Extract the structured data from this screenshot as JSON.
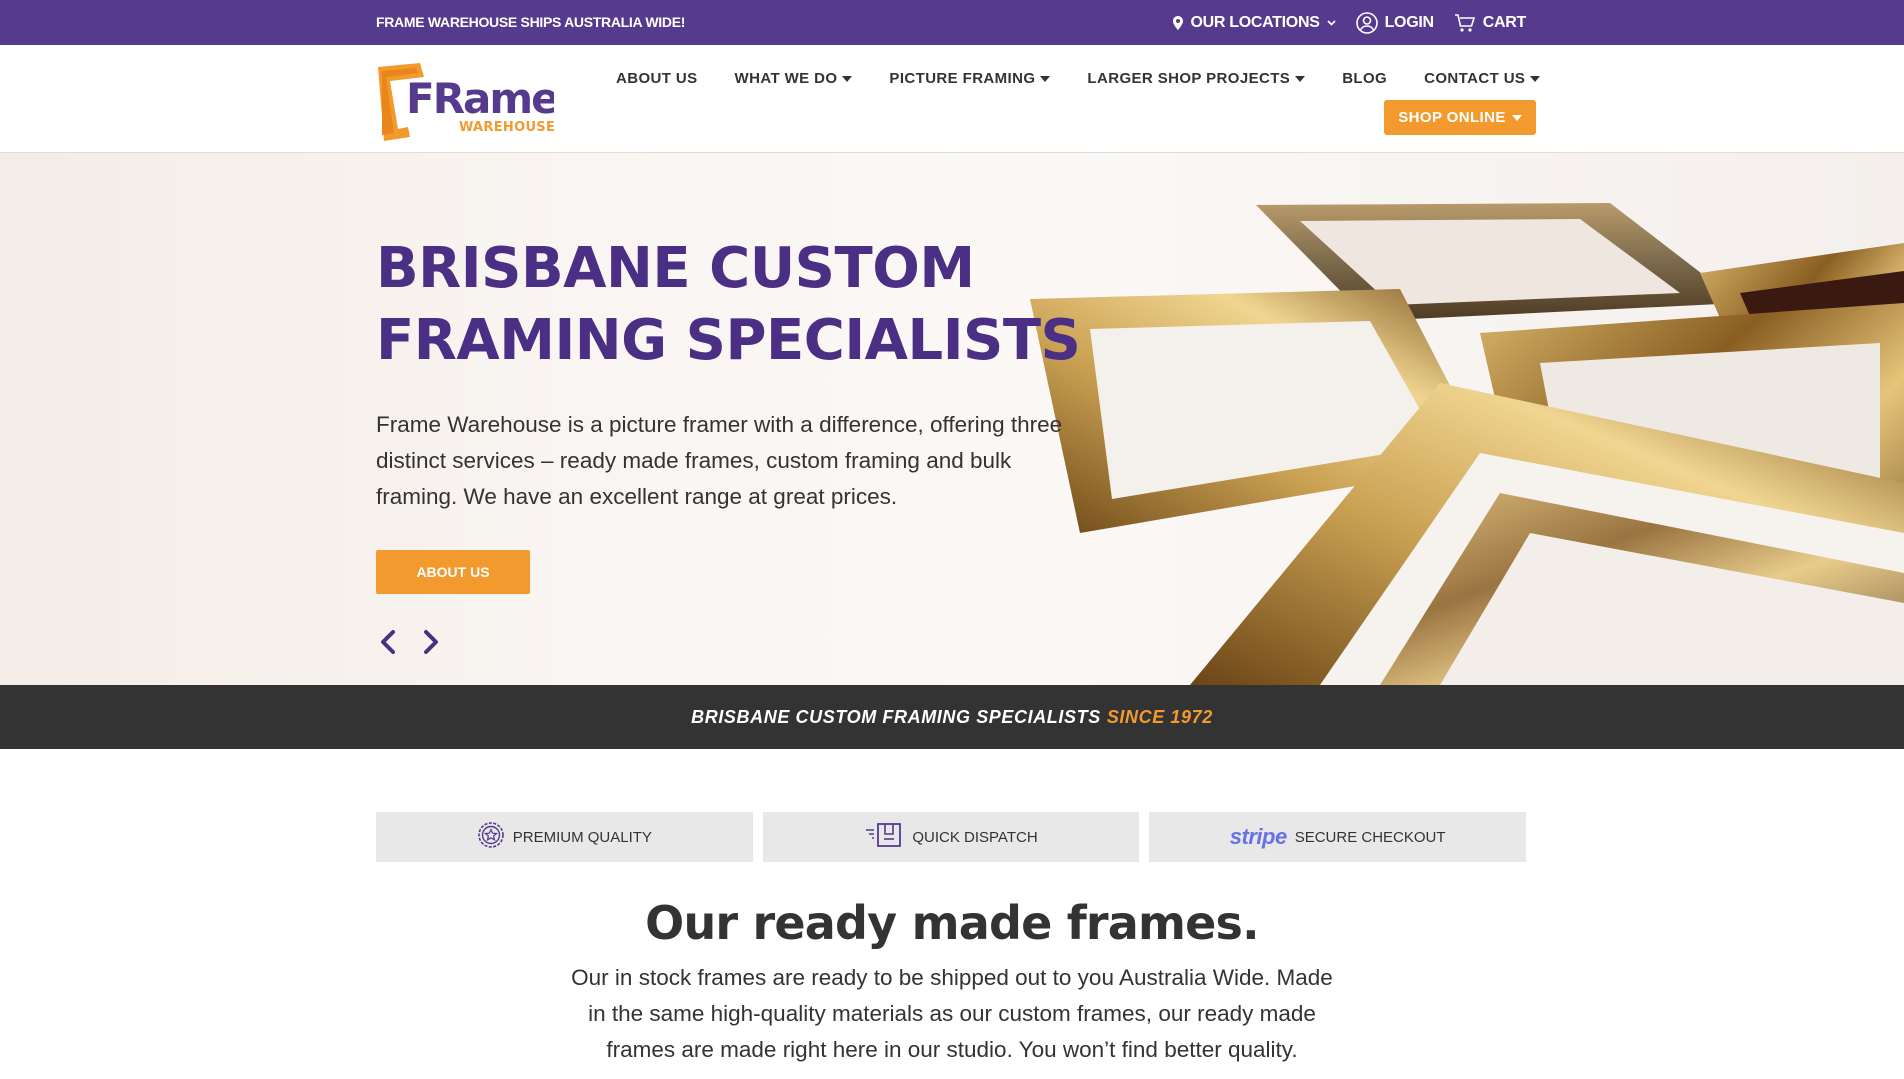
{
  "topbar": {
    "shipping_text": "FRAME WAREHOUSE SHIPS AUSTRALIA WIDE!",
    "locations_label": "OUR LOCATIONS",
    "login_label": "LOGIN",
    "cart_label": "CART"
  },
  "logo": {
    "name": "FRame",
    "sub": "WAREHOUSE"
  },
  "nav": {
    "items": [
      {
        "label": "ABOUT US",
        "dropdown": false
      },
      {
        "label": "WHAT WE DO",
        "dropdown": true
      },
      {
        "label": "PICTURE FRAMING",
        "dropdown": true
      },
      {
        "label": "LARGER SHOP PROJECTS",
        "dropdown": true
      },
      {
        "label": "BLOG",
        "dropdown": false
      },
      {
        "label": "CONTACT US",
        "dropdown": true
      }
    ],
    "shop_online_label": "SHOP ONLINE"
  },
  "hero": {
    "title_line1": "BRISBANE CUSTOM",
    "title_line2": "FRAMING SPECIALISTS",
    "description": "Frame Warehouse is a picture framer with a difference, offering three distinct services – ready made frames, custom framing and bulk framing. We have an excellent range at great prices.",
    "button_label": "ABOUT US"
  },
  "banner": {
    "text": "BRISBANE CUSTOM FRAMING SPECIALISTS",
    "highlight": "SINCE 1972"
  },
  "features": [
    {
      "icon": "star-badge-icon",
      "label": "PREMIUM QUALITY"
    },
    {
      "icon": "dispatch-box-icon",
      "label": "QUICK DISPATCH"
    },
    {
      "icon": "stripe-logo",
      "brand": "stripe",
      "label": "SECURE CHECKOUT"
    }
  ],
  "section": {
    "title": "Our ready made frames.",
    "description": "Our in stock frames are ready to be shipped out to you Australia Wide. Made in the same high-quality materials as our custom frames, our ready made frames are made right here in our studio. You won’t find better quality."
  },
  "colors": {
    "brand_purple": "#553a8e",
    "title_purple": "#4a2f85",
    "accent_orange": "#f29a2e",
    "banner_dark": "#333333",
    "feature_bg": "#e8e8e8",
    "stripe_blue": "#6772e5"
  }
}
